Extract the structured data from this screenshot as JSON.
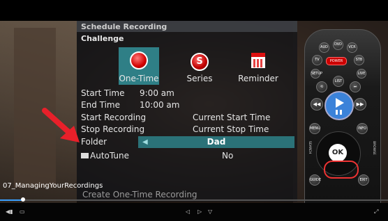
{
  "dialog": {
    "title": "Schedule Recording",
    "program": "Challenge",
    "options": [
      {
        "label": "One-Time",
        "icon": "record-icon"
      },
      {
        "label": "Series",
        "icon": "series-icon",
        "glyph": "S"
      },
      {
        "label": "Reminder",
        "icon": "calendar-icon"
      }
    ],
    "fields": {
      "start_time_label": "Start Time",
      "start_time_value": "9:00 am",
      "end_time_label": "End Time",
      "end_time_value": "10:00 am",
      "start_recording_label": "Start Recording",
      "start_recording_value": "Current Start Time",
      "stop_recording_label": "Stop Recording",
      "stop_recording_value": "Current Stop Time",
      "folder_label": "Folder",
      "folder_value": "Dad",
      "autotune_label": "AutoTune",
      "autotune_value": "No"
    },
    "create_label": "Create One-Time Recording"
  },
  "player": {
    "caption": "07_ManagingYourRecordings",
    "progress_percent": 6
  },
  "remote": {
    "buttons": {
      "aud": "AUD",
      "dvd": "DVD",
      "vcr": "VCR",
      "tv": "TV",
      "power": "POWER",
      "stb": "STB",
      "setup": "SETUP",
      "live": "LIVE",
      "list": "LIST",
      "menu": "MENU",
      "info": "INFO",
      "ok": "OK",
      "guide": "GUIDE",
      "exit": "EXIT",
      "search": "SEARCH",
      "browse": "BROWSE"
    }
  },
  "colors": {
    "highlight": "#2b7278",
    "arrow": "#e8202a",
    "accent": "#3aa0ff"
  }
}
